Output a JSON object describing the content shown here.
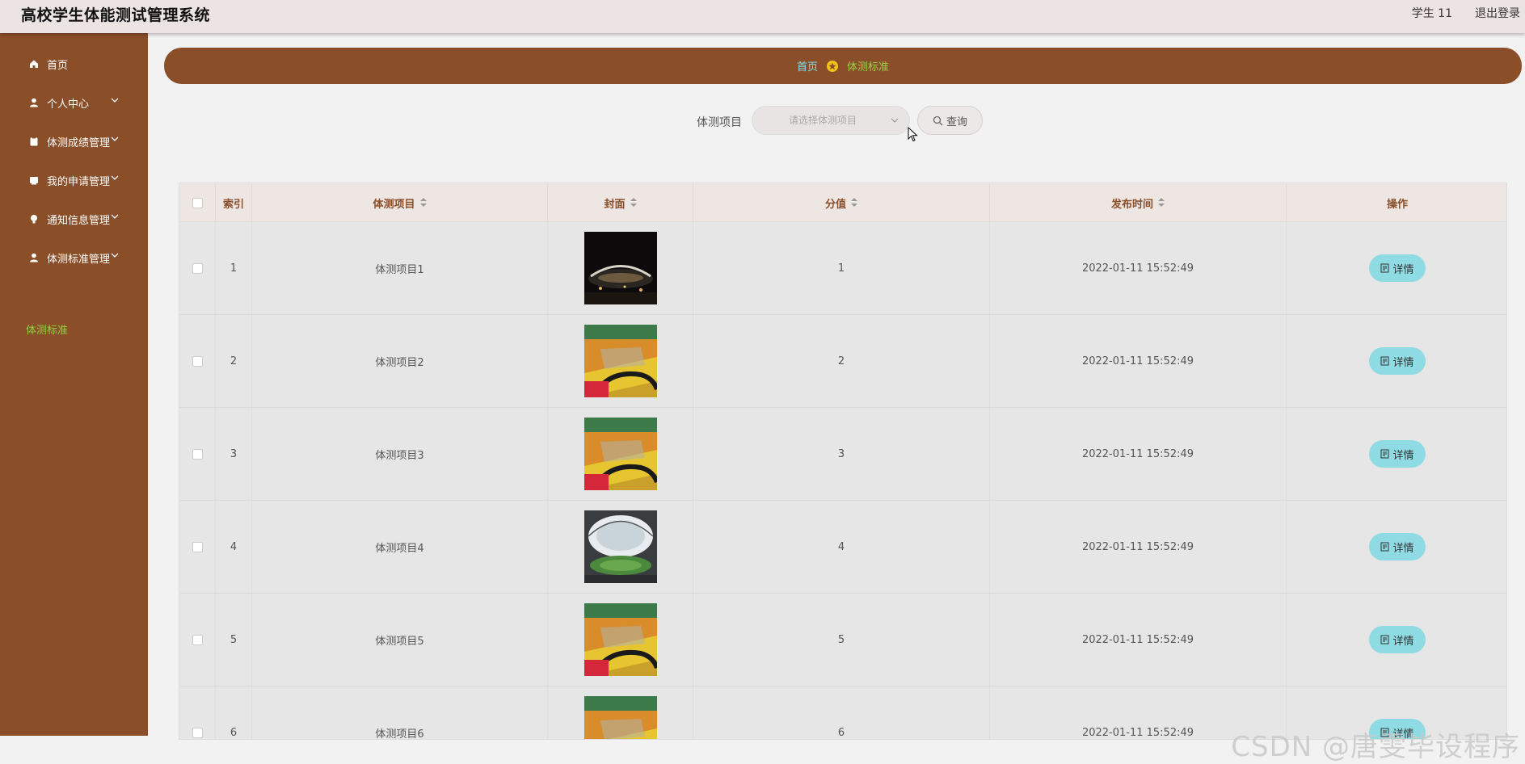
{
  "app": {
    "title": "高校学生体能测试管理系统"
  },
  "topbar": {
    "user": "学生 11",
    "logout": "退出登录"
  },
  "sidebar": {
    "items": [
      {
        "label": "首页"
      },
      {
        "label": "个人中心"
      },
      {
        "label": "体测成绩管理"
      },
      {
        "label": "我的申请管理"
      },
      {
        "label": "通知信息管理"
      },
      {
        "label": "体测标准管理"
      }
    ],
    "active_sub": "体测标准"
  },
  "breadcrumb": {
    "home": "首页",
    "current": "体测标准"
  },
  "search": {
    "label": "体测项目",
    "placeholder": "请选择体测项目",
    "button": "查询"
  },
  "table": {
    "headers": [
      "索引",
      "体测项目",
      "封面",
      "分值",
      "发布时间",
      "操作"
    ],
    "rows": [
      {
        "index": "1",
        "item": "体测项目1",
        "score": "1",
        "time": "2022-01-11 15:52:49",
        "action": "详情",
        "cover": "night-stadium"
      },
      {
        "index": "2",
        "item": "体测项目2",
        "score": "2",
        "time": "2022-01-11 15:52:49",
        "action": "详情",
        "cover": "gym-seats"
      },
      {
        "index": "3",
        "item": "体测项目3",
        "score": "3",
        "time": "2022-01-11 15:52:49",
        "action": "详情",
        "cover": "gym-seats"
      },
      {
        "index": "4",
        "item": "体测项目4",
        "score": "4",
        "time": "2022-01-11 15:52:49",
        "action": "详情",
        "cover": "dome-stadium"
      },
      {
        "index": "5",
        "item": "体测项目5",
        "score": "5",
        "time": "2022-01-11 15:52:49",
        "action": "详情",
        "cover": "gym-seats"
      },
      {
        "index": "6",
        "item": "体测项目6",
        "score": "6",
        "time": "2022-01-11 15:52:49",
        "action": "详情",
        "cover": "gym-seats"
      }
    ]
  },
  "watermark": "CSDN @唐雯毕设程序",
  "colors": {
    "sidebar": "#8a4e29",
    "accent_cyan": "#8fdbe3",
    "active_green": "#8fd13f"
  }
}
